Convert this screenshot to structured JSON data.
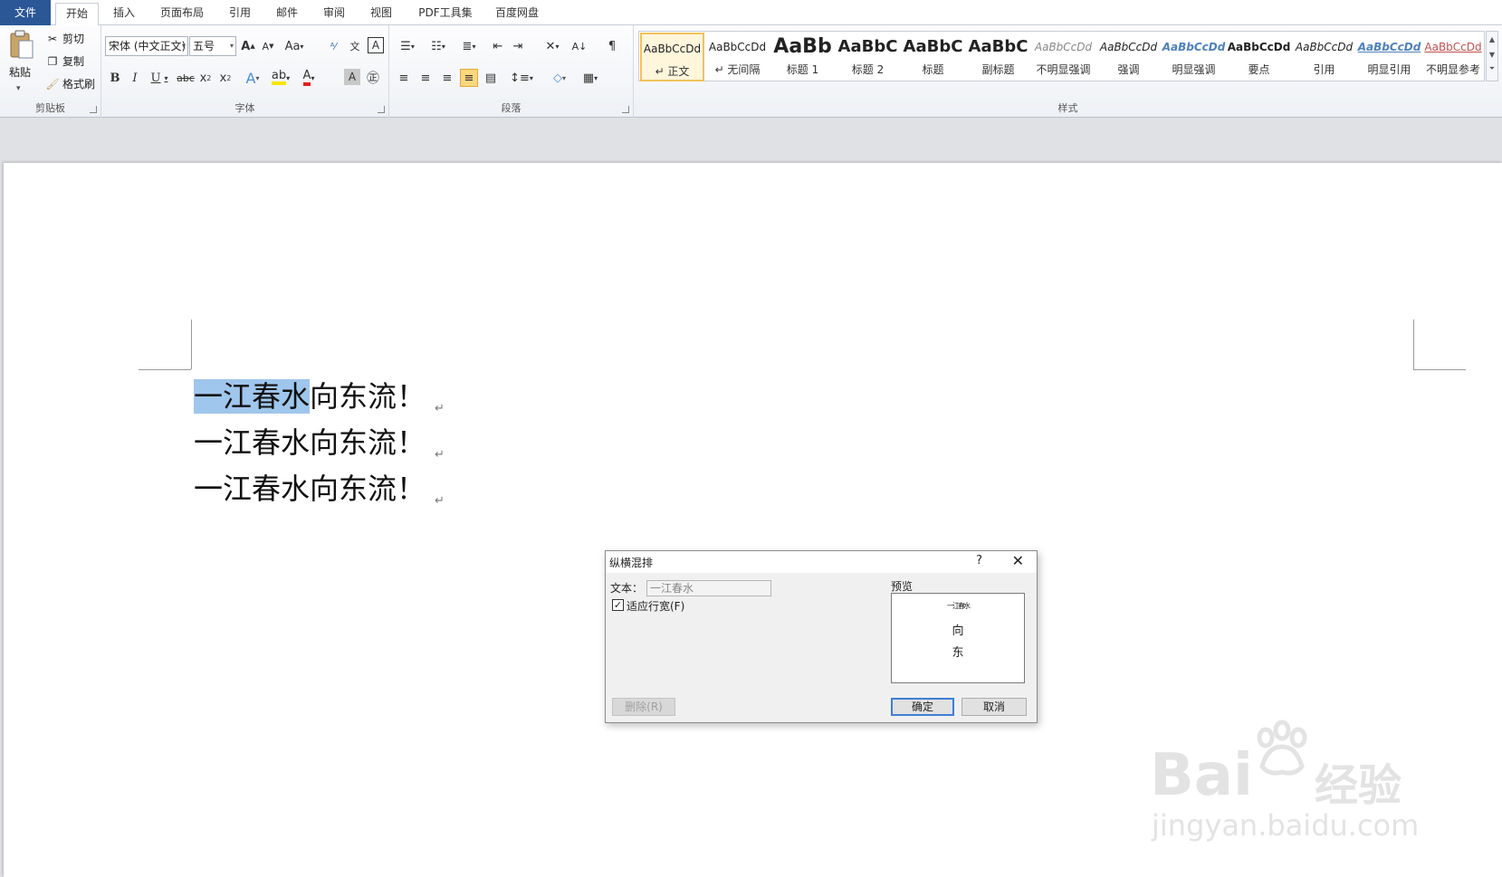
{
  "tabs": {
    "file": "文件",
    "home": "开始",
    "insert": "插入",
    "layout": "页面布局",
    "references": "引用",
    "mailings": "邮件",
    "review": "审阅",
    "view": "视图",
    "pdf": "PDF工具集",
    "baidu": "百度网盘"
  },
  "clipboard": {
    "paste": "粘贴",
    "cut": "剪切",
    "copy": "复制",
    "format_painter": "格式刷",
    "group_label": "剪贴板"
  },
  "font": {
    "name": "宋体 (中文正文)",
    "size": "五号",
    "group_label": "字体"
  },
  "paragraph": {
    "group_label": "段落"
  },
  "styles": {
    "group_label": "样式",
    "items": [
      {
        "sample": "AaBbCcDd",
        "name": "↵ 正文"
      },
      {
        "sample": "AaBbCcDd",
        "name": "↵ 无间隔"
      },
      {
        "sample": "AaBb",
        "name": "标题 1"
      },
      {
        "sample": "AaBbC",
        "name": "标题 2"
      },
      {
        "sample": "AaBbC",
        "name": "标题"
      },
      {
        "sample": "AaBbC",
        "name": "副标题"
      },
      {
        "sample": "AaBbCcDd",
        "name": "不明显强调"
      },
      {
        "sample": "AaBbCcDd",
        "name": "强调"
      },
      {
        "sample": "AaBbCcDd",
        "name": "明显强调"
      },
      {
        "sample": "AaBbCcDd",
        "name": "要点"
      },
      {
        "sample": "AaBbCcDd",
        "name": "引用"
      },
      {
        "sample": "AaBbCcDd",
        "name": "明显引用"
      },
      {
        "sample": "AaBbCcDd",
        "name": "不明显参考"
      }
    ]
  },
  "document": {
    "lines": [
      {
        "highlight": "一江春水",
        "rest": "向东流！"
      },
      {
        "highlight": "",
        "rest": "一江春水向东流！"
      },
      {
        "highlight": "",
        "rest": "一江春水向东流！"
      }
    ],
    "para_mark": "↵"
  },
  "dialog": {
    "title": "纵横混排",
    "help": "?",
    "close": "✕",
    "text_label": "文本：",
    "text_value": "一江春水",
    "fit_label": "适应行宽(F)",
    "fit_checked": "✓",
    "preview_label": "预览",
    "preview_chars": [
      "一江春水",
      "向",
      "东"
    ],
    "delete_button": "删除(R)",
    "ok_button": "确定",
    "cancel_button": "取消"
  },
  "watermark": {
    "brand": "Bai",
    "brand2": "经验",
    "url": "jingyan.baidu.com"
  }
}
